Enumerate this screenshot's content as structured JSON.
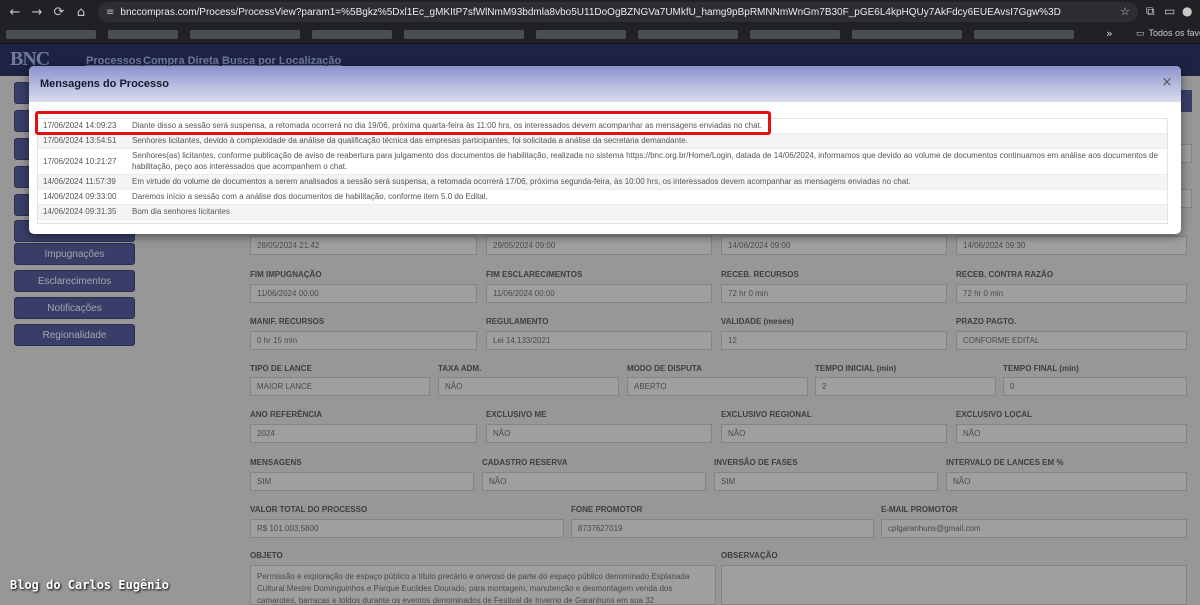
{
  "browser": {
    "url": "bnccompras.com/Process/ProcessView?param1=%5Bgkz%5Dxl1Ec_gMKItP7sfWlNmM93bdmla8vbo5U11DoOgBZNGVa7UMkfU_hamg9pBpRMNNmWnGm7B30F_pGE6L4kpHQUy7AkFdcy6EUEAvsI7Ggw%3D",
    "bookmarks_folder": "Todos os favoritos"
  },
  "site": {
    "logo": "BNC",
    "nav": [
      "Processos",
      "Compra Direta",
      "Busca por Localização"
    ],
    "sidebar": [
      "Impugnações",
      "Esclarecimentos",
      "Notificações",
      "Regionalidade"
    ]
  },
  "form": {
    "row1_values": [
      "28/05/2024 21:42",
      "29/05/2024 09:00",
      "14/06/2024 09:00",
      "14/06/2024 09:30"
    ],
    "fields": [
      {
        "label": "FIM IMPUGNAÇÃO",
        "value": "11/06/2024 00:00"
      },
      {
        "label": "FIM ESCLARECIMENTOS",
        "value": "11/06/2024 00:00"
      },
      {
        "label": "RECEB. RECURSOS",
        "value": "72 hr 0 min"
      },
      {
        "label": "RECEB. CONTRA RAZÃO",
        "value": "72 hr 0 min"
      },
      {
        "label": "MANIF. RECURSOS",
        "value": "0 hr 15 min"
      },
      {
        "label": "REGULAMENTO",
        "value": "Lei 14.133/2021"
      },
      {
        "label": "VALIDADE (meses)",
        "value": "12"
      },
      {
        "label": "PRAZO PAGTO.",
        "value": "CONFORME EDITAL"
      },
      {
        "label": "TIPO DE LANCE",
        "value": "MAIOR LANCE"
      },
      {
        "label": "TAXA ADM.",
        "value": "NÃO"
      },
      {
        "label": "MODO DE DISPUTA",
        "value": "ABERTO"
      },
      {
        "label": "TEMPO INICIAL (min)",
        "value": "2"
      },
      {
        "label": "TEMPO FINAL (min)",
        "value": "0"
      },
      {
        "label": "ANO REFERÊNCIA",
        "value": "2024"
      },
      {
        "label": "EXCLUSIVO ME",
        "value": "NÃO"
      },
      {
        "label": "EXCLUSIVO REGIONAL",
        "value": "NÃO"
      },
      {
        "label": "EXCLUSIVO LOCAL",
        "value": "NÃO"
      },
      {
        "label": "MENSAGENS",
        "value": "SIM"
      },
      {
        "label": "CADASTRO RESERVA",
        "value": "NÃO"
      },
      {
        "label": "INVERSÃO DE FASES",
        "value": "SIM"
      },
      {
        "label": "INTERVALO DE LANCES EM %",
        "value": "NÃO"
      },
      {
        "label": "VALOR TOTAL DO PROCESSO",
        "value": "R$ 101.003,5800"
      },
      {
        "label": "FONE PROMOTOR",
        "value": "8737627019"
      },
      {
        "label": "E-MAIL PROMOTOR",
        "value": "cplgaranhuns@gmail.com"
      }
    ],
    "objeto_label": "OBJETO",
    "observacao_label": "OBSERVAÇÃO",
    "objeto_text": "Permissão e exploração de espaço público a título precário e oneroso de parte do espaço público denominado Esplanada Cultural Mestre Dominguinhos e Parque Euclides Dourado, para montagem, manutenção e desmontagem venda dos camarotes, barracas e toldos durante os eventos denominados de Festival de Inverno de Garanhuns em sua 32"
  },
  "modal": {
    "title": "Mensagens do Processo",
    "close": "×",
    "messages": [
      {
        "date": "17/06/2024 14:09:23",
        "text": "Diante disso a sessão será suspensa, a retomada ocorrerá no dia 19/06, próxima quarta-feira às 11:00 hrs, os interessados devem acompanhar as mensagens enviadas no chat."
      },
      {
        "date": "17/06/2024 13:54:51",
        "text": "Senhores licitantes, devido à complexidade da análise da qualificação técnica das empresas participantes, foi solicitada a análise da secretaria demandante."
      },
      {
        "date": "17/06/2024 10:21:27",
        "text": "Senhores(as) licitantes, conforme publicação de aviso de reabertura para julgamento dos documentos de habilitação, realizada no sistema https://bnc.org.br/Home/Login, datada de 14/06/2024, informamos que devido ao volume de documentos continuamos em análise aos documentos de habilitação, peço aos interessados que acompanhem o chat."
      },
      {
        "date": "14/06/2024 11:57:39",
        "text": "Em virtude do volume de documentos a serem analisados a sessão será suspensa, a retomada ocorrerá 17/06, próxima segunda-feira, às 10:00 hrs, os interessados devem acompanhar as mensagens enviadas no chat."
      },
      {
        "date": "14/06/2024 09:33:00",
        "text": "Daremos início a sessão com a análise dos documentos de habilitação, conforme item 5.0 do Edital."
      },
      {
        "date": "14/06/2024 09:31:35",
        "text": "Bom dia senhores licitantes"
      }
    ]
  },
  "watermark": "Blog do Carlos Eugênio",
  "colors": {
    "highlight": "#e31010",
    "header_bar": "#2c3360",
    "button": "#525a96"
  }
}
